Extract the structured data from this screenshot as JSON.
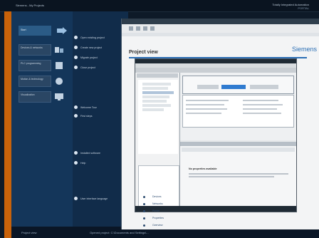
{
  "topbar": {
    "title": "Siemens - My Projects",
    "right1": "Totally Integrated Automation",
    "right2": "PORTAL"
  },
  "nav": {
    "start_label": "Start",
    "cards": [
      "Devices & networks",
      "PLC programming",
      "Motion & technology",
      "Visualization"
    ]
  },
  "middle": {
    "items": [
      "Open existing project",
      "Create new project",
      "Migrate project",
      "Close project",
      "Welcome Tour",
      "First steps",
      "Installed software",
      "Help",
      "User interface language"
    ]
  },
  "status": {
    "left": "Project view",
    "mid": "Opened project: C:\\Documents and Settings\\..."
  },
  "window": {
    "heading": "Project view",
    "logo": "Siemens"
  },
  "inner": {
    "bottom_heading": "No properties available",
    "links": [
      "Devices",
      "Networks",
      "Printer",
      "Properties",
      "Overview"
    ]
  },
  "colors": {
    "accent_orange": "#c8620a",
    "nav_blue": "#14365a",
    "link_blue": "#2c6fb5"
  }
}
